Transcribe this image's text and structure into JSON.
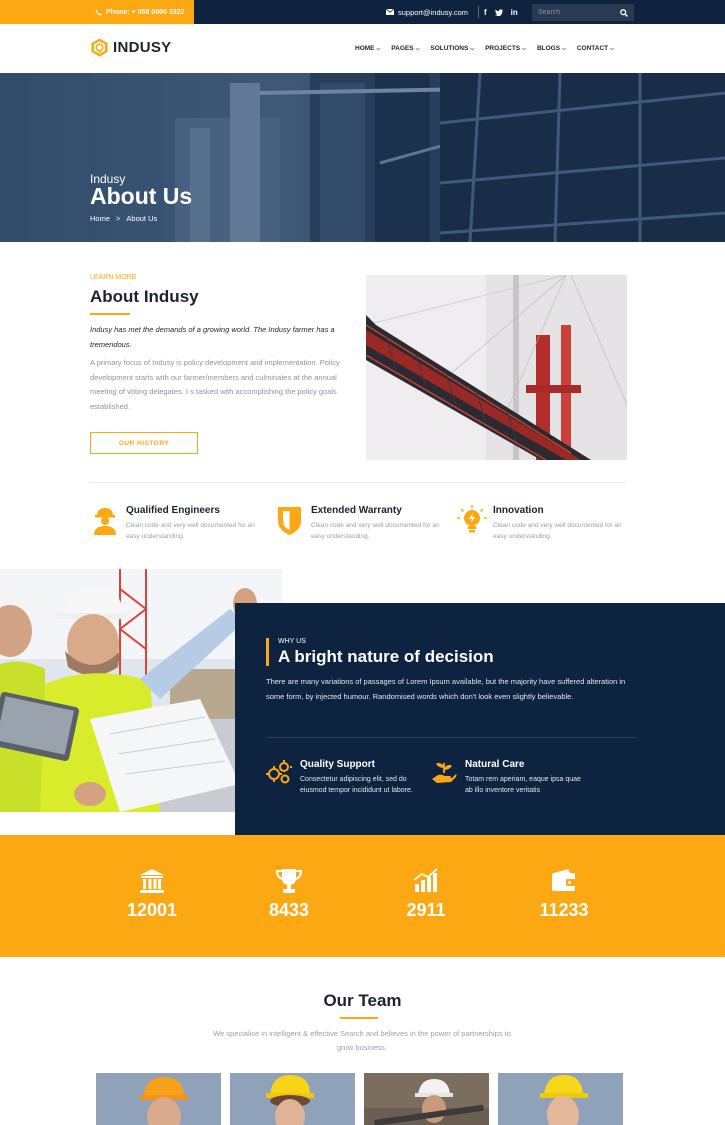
{
  "topbar": {
    "phone": "Phone: + 058 0000 3322",
    "email": "support@indusy.com",
    "social": [
      "f",
      "t",
      "in"
    ],
    "search_placeholder": "Search"
  },
  "brand": {
    "name": "INDUSY"
  },
  "nav": {
    "items": [
      {
        "label": "HOME"
      },
      {
        "label": "PAGES"
      },
      {
        "label": "SOLUTIONS"
      },
      {
        "label": "PROJECTS"
      },
      {
        "label": "BLOGS"
      },
      {
        "label": "CONTACT"
      }
    ]
  },
  "hero": {
    "subtitle": "Indusy",
    "title": "About Us",
    "breadcrumb": {
      "home": "Home",
      "separator": ">",
      "current": "About Us"
    }
  },
  "about": {
    "label": "LEARN MORE",
    "title": "About Indusy",
    "lead": "Indusy has met the demands of a growing world. The Indusy farmer has a tremendous.",
    "body": "A primary focus of Indusy is policy development and implementation. Policy development starts with our farmer/members and culminates at the annual meeting of voting delegates. I s tasked with accomplishing the policy goals established.",
    "button": "OUR HISTORY"
  },
  "features": [
    {
      "icon": "engineer-icon",
      "title": "Qualified Engineers",
      "desc": "Clean code and very well documented for an easy understanding."
    },
    {
      "icon": "shield-icon",
      "title": "Extended Warranty",
      "desc": "Clean code and very well documented for an easy understanding."
    },
    {
      "icon": "lightbulb-icon",
      "title": "Innovation",
      "desc": "Clean code and very well documented for an easy understanding."
    }
  ],
  "why": {
    "label": "WHY US",
    "title": "A bright nature of decision",
    "text": "There are many variations of passages of Lorem Ipsum available, but the majority have suffered alteration in some form, by injected humour. Randomised words which don't look even slightly believable.",
    "items": [
      {
        "icon": "gears-icon",
        "title": "Quality Support",
        "desc": "Consectetur adipiscing elit, sed do eiusmod tempor incididunt ut labore."
      },
      {
        "icon": "hand-plant-icon",
        "title": "Natural Care",
        "desc": "Totam rem aperiam, eaque ipsa quae ab illo inventore veritatis"
      }
    ]
  },
  "counters": [
    {
      "icon": "bank-icon",
      "value": "12001"
    },
    {
      "icon": "trophy-icon",
      "value": "8433"
    },
    {
      "icon": "chart-icon",
      "value": "2911"
    },
    {
      "icon": "wallet-icon",
      "value": "11233"
    }
  ],
  "team": {
    "title": "Our Team",
    "desc": "We specialise in intelligent & effective Search and believes in the power of partnerships to grow business."
  },
  "colors": {
    "accent": "#fba813",
    "navy": "#0e2340"
  }
}
